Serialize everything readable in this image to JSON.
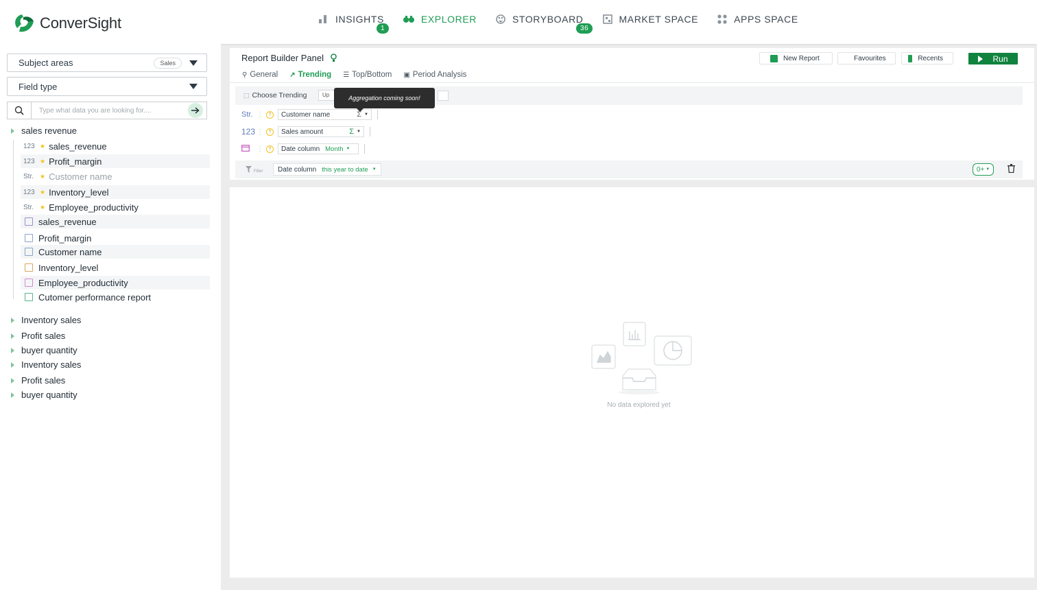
{
  "brand": {
    "name": "ConverSight",
    "accent": "#1f9d55"
  },
  "nav": [
    {
      "label": "INSIGHTS",
      "icon": "bar-chart-icon",
      "badge": "1"
    },
    {
      "label": "EXPLORER",
      "icon": "binoculars-icon",
      "active": true
    },
    {
      "label": "STORYBOARD",
      "icon": "palette-icon",
      "badge": "36"
    },
    {
      "label": "MARKET SPACE",
      "icon": "market-icon"
    },
    {
      "label": "APPS SPACE",
      "icon": "apps-grid-icon"
    }
  ],
  "left": {
    "subject_areas": {
      "label": "Subject areas",
      "pill": "Sales"
    },
    "field_type": {
      "label": "Field type"
    },
    "search": {
      "placeholder": "Type what data you are looking for...."
    },
    "groups": [
      {
        "label": "sales revenue",
        "expanded": true
      },
      {
        "label": "Inventory sales"
      },
      {
        "label": "Profit sales"
      },
      {
        "label": "buyer quantity"
      },
      {
        "label": "Inventory sales"
      },
      {
        "label": "Profit sales"
      },
      {
        "label": "buyer quantity"
      }
    ],
    "items": [
      {
        "type": "123",
        "star": true,
        "label": "sales_revenue"
      },
      {
        "type": "123",
        "star": true,
        "label": "Profit_margin"
      },
      {
        "type": "Str.",
        "star": true,
        "label": "Customer name",
        "muted": true
      },
      {
        "type": "123",
        "star": true,
        "label": "Inventory_level"
      },
      {
        "type": "Str.",
        "star": true,
        "label": "Employee_productivity"
      },
      {
        "icon": "monitor-icon",
        "label": "sales_revenue"
      },
      {
        "icon": "document-icon",
        "label": "Profit_margin"
      },
      {
        "icon": "document-icon",
        "label": "Customer name"
      },
      {
        "icon": "document-icon",
        "label": "Inventory_level"
      },
      {
        "icon": "calendar-icon",
        "label": "Employee_productivity"
      },
      {
        "icon": "bar-chart-icon",
        "label": "Cutomer performance report"
      }
    ]
  },
  "builder": {
    "title": "Report Builder Panel",
    "actions": {
      "new_report": "New Report",
      "favourites": "Favourites",
      "recents": "Recents",
      "run": "Run"
    },
    "tabs": [
      "General",
      "Trending",
      "Top/Bottom",
      "Period Analysis"
    ],
    "active_tab": "Trending",
    "trending": {
      "label": "Choose Trending",
      "value": "Up"
    },
    "tooltip": "Aggregation coming soon!",
    "fields": [
      {
        "type": "Str.",
        "name": "Customer name",
        "agg": "Σ"
      },
      {
        "type": "123",
        "name": "Sales amount",
        "agg": "Σ"
      },
      {
        "type": "date",
        "name": "Date column",
        "grain": "Month"
      }
    ],
    "filter": {
      "label": "Filter",
      "field": "Date column",
      "value": "this year to date",
      "count": "0+"
    }
  },
  "results": {
    "empty_text": "No data explored yet"
  }
}
